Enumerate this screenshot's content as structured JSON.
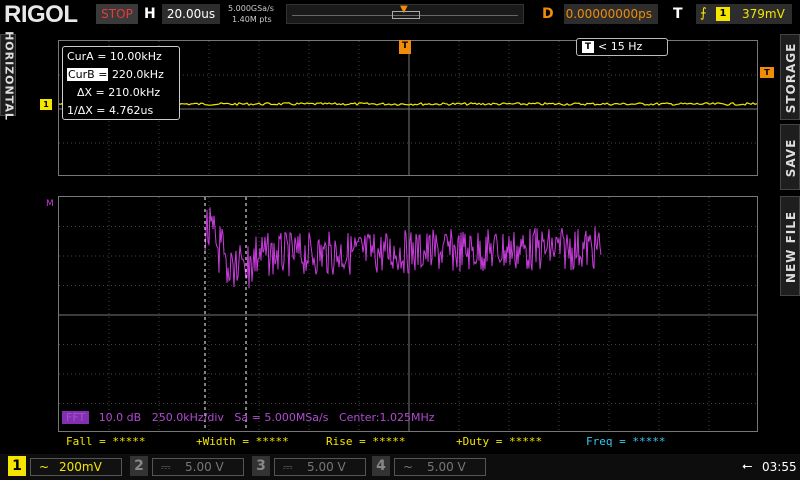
{
  "topbar": {
    "brand": "RIGOL",
    "run_state": "STOP",
    "timebase_letter": "H",
    "timebase": "20.00us",
    "sample_rate": "5.000GSa/s",
    "mem_points": "1.40M pts",
    "delay_letter": "D",
    "delay": "0.00000000ps",
    "trigger_letter": "T",
    "trigger_source": "1",
    "trigger_level": "379mV"
  },
  "side_tabs": {
    "left": "HORIZONTAL",
    "storage": "STORAGE",
    "save": "SAVE",
    "new_file": "NEW FILE"
  },
  "cursor_box": {
    "cur_a_label": "CurA",
    "cur_a": "= 10.00kHz",
    "cur_b_label": "CurB =",
    "cur_b": "220.0kHz",
    "delta_x": "ΔX = 210.0kHz",
    "inv_delta_x": "1/ΔX = 4.762us"
  },
  "freq_counter": {
    "icon": "T",
    "value": "< 15 Hz"
  },
  "markers": {
    "trigger": "T",
    "ch1": "1",
    "math": "M"
  },
  "fft": {
    "tag": "FFT",
    "scale": "10.0 dB",
    "hdiv": "250.0kHz/div",
    "sa": "Sa = 5.000MSa/s",
    "center": "Center:1.025MHz"
  },
  "measurements": [
    {
      "label": "Fall = *****",
      "color": "#f5e600"
    },
    {
      "label": "+Width = *****",
      "color": "#f5e600"
    },
    {
      "label": "Rise = *****",
      "color": "#f5e600"
    },
    {
      "label": "+Duty = *****",
      "color": "#f5e600"
    },
    {
      "label": "Freq = *****",
      "color": "#38c8f0"
    }
  ],
  "channels": [
    {
      "num": "1",
      "coupling": "~",
      "scale": "200mV",
      "active": true
    },
    {
      "num": "2",
      "coupling": "⎓",
      "scale": "5.00 V",
      "active": false
    },
    {
      "num": "3",
      "coupling": "⎓",
      "scale": "5.00 V",
      "active": false
    },
    {
      "num": "4",
      "coupling": "~",
      "scale": "5.00 V",
      "active": false
    }
  ],
  "status": {
    "usb_icon": "usb-icon",
    "time": "03:55"
  },
  "colors": {
    "ch1": "#f5e600",
    "math": "#c83cdc",
    "trigger": "#f08c0a",
    "stop": "#e83a3a",
    "freq": "#38c8f0"
  }
}
